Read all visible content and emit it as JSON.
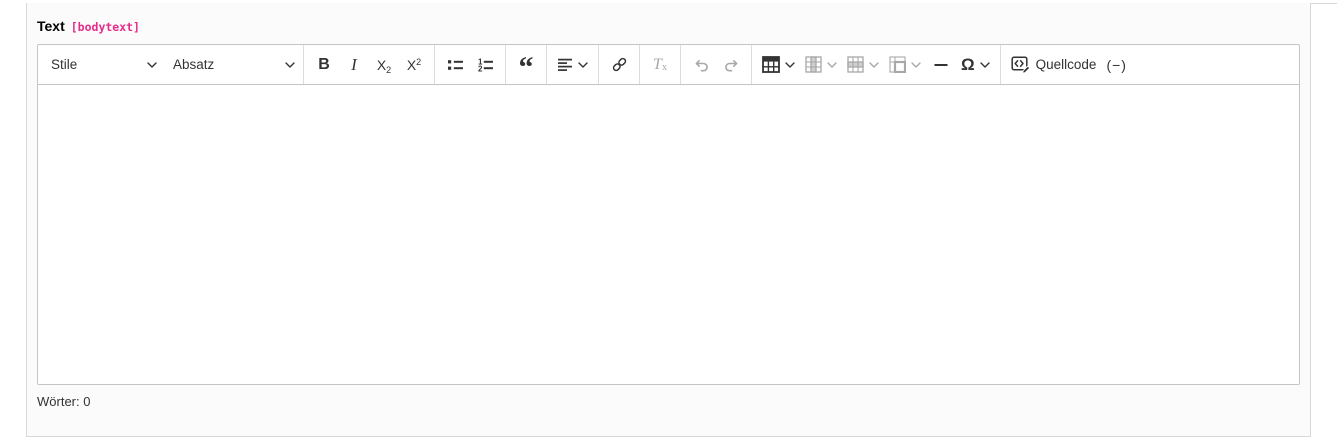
{
  "field": {
    "label": "Text",
    "name": "[bodytext]"
  },
  "toolbar": {
    "styles_label": "Stile",
    "format_label": "Absatz",
    "bold_glyph": "B",
    "italic_glyph": "I",
    "sub_base": "X",
    "sub_mark": "2",
    "sup_base": "X",
    "sup_mark": "2",
    "list_marks": {
      "first": "1",
      "second": "2"
    },
    "blockquote_glyph": "“",
    "remove_format": {
      "base": "T",
      "mark": "x"
    },
    "specialchar_glyph": "Ω",
    "source_label": "Quellcode",
    "soft_hyphen_label": "(−)"
  },
  "editor": {
    "content": ""
  },
  "footer": {
    "words_label": "Wörter:",
    "words_count": "0"
  },
  "colors": {
    "accent_field_name": "#e62b8a",
    "icon": "#333333",
    "icon_disabled": "#a8a8a8",
    "editor_border": "#c4c4c4",
    "panel_border": "#d8d8d8",
    "text": "#333333"
  }
}
